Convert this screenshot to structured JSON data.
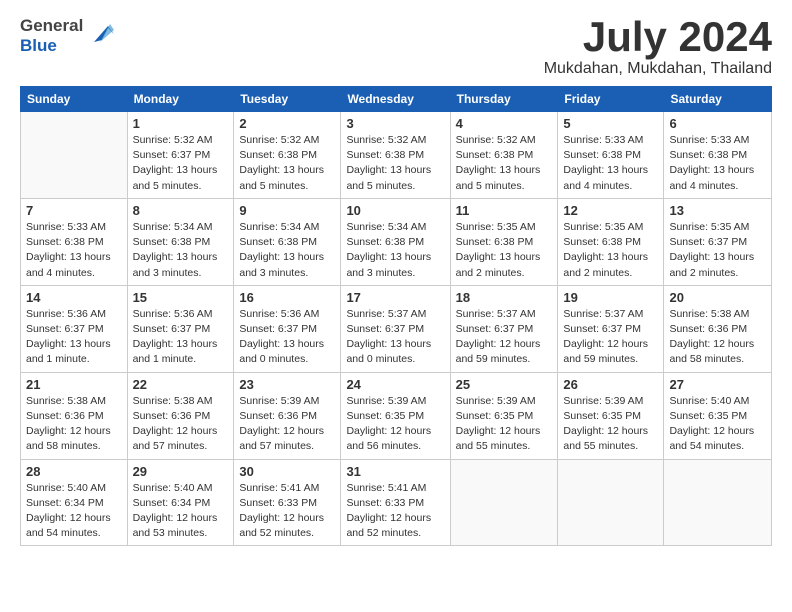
{
  "logo": {
    "general": "General",
    "blue": "Blue"
  },
  "title": "July 2024",
  "location": "Mukdahan, Mukdahan, Thailand",
  "weekdays": [
    "Sunday",
    "Monday",
    "Tuesday",
    "Wednesday",
    "Thursday",
    "Friday",
    "Saturday"
  ],
  "weeks": [
    [
      {
        "day": "",
        "sunrise": "",
        "sunset": "",
        "daylight": ""
      },
      {
        "day": "1",
        "sunrise": "Sunrise: 5:32 AM",
        "sunset": "Sunset: 6:37 PM",
        "daylight": "Daylight: 13 hours and 5 minutes."
      },
      {
        "day": "2",
        "sunrise": "Sunrise: 5:32 AM",
        "sunset": "Sunset: 6:38 PM",
        "daylight": "Daylight: 13 hours and 5 minutes."
      },
      {
        "day": "3",
        "sunrise": "Sunrise: 5:32 AM",
        "sunset": "Sunset: 6:38 PM",
        "daylight": "Daylight: 13 hours and 5 minutes."
      },
      {
        "day": "4",
        "sunrise": "Sunrise: 5:32 AM",
        "sunset": "Sunset: 6:38 PM",
        "daylight": "Daylight: 13 hours and 5 minutes."
      },
      {
        "day": "5",
        "sunrise": "Sunrise: 5:33 AM",
        "sunset": "Sunset: 6:38 PM",
        "daylight": "Daylight: 13 hours and 4 minutes."
      },
      {
        "day": "6",
        "sunrise": "Sunrise: 5:33 AM",
        "sunset": "Sunset: 6:38 PM",
        "daylight": "Daylight: 13 hours and 4 minutes."
      }
    ],
    [
      {
        "day": "7",
        "sunrise": "Sunrise: 5:33 AM",
        "sunset": "Sunset: 6:38 PM",
        "daylight": "Daylight: 13 hours and 4 minutes."
      },
      {
        "day": "8",
        "sunrise": "Sunrise: 5:34 AM",
        "sunset": "Sunset: 6:38 PM",
        "daylight": "Daylight: 13 hours and 3 minutes."
      },
      {
        "day": "9",
        "sunrise": "Sunrise: 5:34 AM",
        "sunset": "Sunset: 6:38 PM",
        "daylight": "Daylight: 13 hours and 3 minutes."
      },
      {
        "day": "10",
        "sunrise": "Sunrise: 5:34 AM",
        "sunset": "Sunset: 6:38 PM",
        "daylight": "Daylight: 13 hours and 3 minutes."
      },
      {
        "day": "11",
        "sunrise": "Sunrise: 5:35 AM",
        "sunset": "Sunset: 6:38 PM",
        "daylight": "Daylight: 13 hours and 2 minutes."
      },
      {
        "day": "12",
        "sunrise": "Sunrise: 5:35 AM",
        "sunset": "Sunset: 6:38 PM",
        "daylight": "Daylight: 13 hours and 2 minutes."
      },
      {
        "day": "13",
        "sunrise": "Sunrise: 5:35 AM",
        "sunset": "Sunset: 6:37 PM",
        "daylight": "Daylight: 13 hours and 2 minutes."
      }
    ],
    [
      {
        "day": "14",
        "sunrise": "Sunrise: 5:36 AM",
        "sunset": "Sunset: 6:37 PM",
        "daylight": "Daylight: 13 hours and 1 minute."
      },
      {
        "day": "15",
        "sunrise": "Sunrise: 5:36 AM",
        "sunset": "Sunset: 6:37 PM",
        "daylight": "Daylight: 13 hours and 1 minute."
      },
      {
        "day": "16",
        "sunrise": "Sunrise: 5:36 AM",
        "sunset": "Sunset: 6:37 PM",
        "daylight": "Daylight: 13 hours and 0 minutes."
      },
      {
        "day": "17",
        "sunrise": "Sunrise: 5:37 AM",
        "sunset": "Sunset: 6:37 PM",
        "daylight": "Daylight: 13 hours and 0 minutes."
      },
      {
        "day": "18",
        "sunrise": "Sunrise: 5:37 AM",
        "sunset": "Sunset: 6:37 PM",
        "daylight": "Daylight: 12 hours and 59 minutes."
      },
      {
        "day": "19",
        "sunrise": "Sunrise: 5:37 AM",
        "sunset": "Sunset: 6:37 PM",
        "daylight": "Daylight: 12 hours and 59 minutes."
      },
      {
        "day": "20",
        "sunrise": "Sunrise: 5:38 AM",
        "sunset": "Sunset: 6:36 PM",
        "daylight": "Daylight: 12 hours and 58 minutes."
      }
    ],
    [
      {
        "day": "21",
        "sunrise": "Sunrise: 5:38 AM",
        "sunset": "Sunset: 6:36 PM",
        "daylight": "Daylight: 12 hours and 58 minutes."
      },
      {
        "day": "22",
        "sunrise": "Sunrise: 5:38 AM",
        "sunset": "Sunset: 6:36 PM",
        "daylight": "Daylight: 12 hours and 57 minutes."
      },
      {
        "day": "23",
        "sunrise": "Sunrise: 5:39 AM",
        "sunset": "Sunset: 6:36 PM",
        "daylight": "Daylight: 12 hours and 57 minutes."
      },
      {
        "day": "24",
        "sunrise": "Sunrise: 5:39 AM",
        "sunset": "Sunset: 6:35 PM",
        "daylight": "Daylight: 12 hours and 56 minutes."
      },
      {
        "day": "25",
        "sunrise": "Sunrise: 5:39 AM",
        "sunset": "Sunset: 6:35 PM",
        "daylight": "Daylight: 12 hours and 55 minutes."
      },
      {
        "day": "26",
        "sunrise": "Sunrise: 5:39 AM",
        "sunset": "Sunset: 6:35 PM",
        "daylight": "Daylight: 12 hours and 55 minutes."
      },
      {
        "day": "27",
        "sunrise": "Sunrise: 5:40 AM",
        "sunset": "Sunset: 6:35 PM",
        "daylight": "Daylight: 12 hours and 54 minutes."
      }
    ],
    [
      {
        "day": "28",
        "sunrise": "Sunrise: 5:40 AM",
        "sunset": "Sunset: 6:34 PM",
        "daylight": "Daylight: 12 hours and 54 minutes."
      },
      {
        "day": "29",
        "sunrise": "Sunrise: 5:40 AM",
        "sunset": "Sunset: 6:34 PM",
        "daylight": "Daylight: 12 hours and 53 minutes."
      },
      {
        "day": "30",
        "sunrise": "Sunrise: 5:41 AM",
        "sunset": "Sunset: 6:33 PM",
        "daylight": "Daylight: 12 hours and 52 minutes."
      },
      {
        "day": "31",
        "sunrise": "Sunrise: 5:41 AM",
        "sunset": "Sunset: 6:33 PM",
        "daylight": "Daylight: 12 hours and 52 minutes."
      },
      {
        "day": "",
        "sunrise": "",
        "sunset": "",
        "daylight": ""
      },
      {
        "day": "",
        "sunrise": "",
        "sunset": "",
        "daylight": ""
      },
      {
        "day": "",
        "sunrise": "",
        "sunset": "",
        "daylight": ""
      }
    ]
  ]
}
